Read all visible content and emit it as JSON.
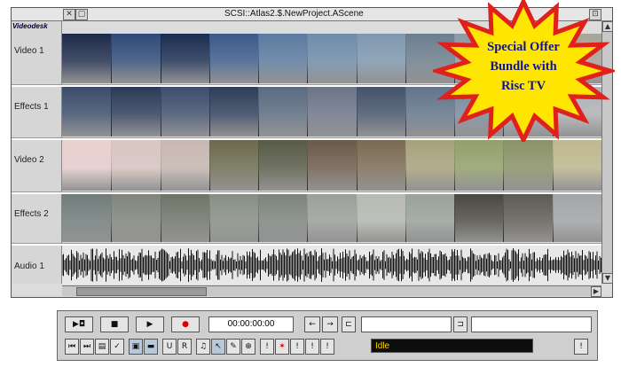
{
  "window": {
    "title": "SCSI::Atlas2.$.NewProject.AScene",
    "app_badge": "Videodesk",
    "close_glyph": "✕",
    "iconize_glyph": "▢",
    "toggle_glyph": "⊡"
  },
  "tracks": [
    {
      "label": "Video 1",
      "colors": [
        "#1d2a4a",
        "#2e4a78",
        "#1a2c50",
        "#3b5a8a",
        "#5a7aa0",
        "#6e8caa",
        "#7f98b0",
        "#6c7e8e",
        "#8a9aa6",
        "#b9c0c4",
        "#a8a49a"
      ]
    },
    {
      "label": "Effects 1",
      "colors": [
        "#3a4c6a",
        "#2c3a58",
        "#3d4d6c",
        "#2f3d5a",
        "#5a6a80",
        "#6c7488",
        "#44526a",
        "#62748a",
        "#7a8a9c",
        "#9aa6b2",
        "#b0b4b6"
      ]
    },
    {
      "label": "Video 2",
      "colors": [
        "#e9d0cf",
        "#d9c6c2",
        "#c8b8b2",
        "#6b6a4e",
        "#565a46",
        "#6a5a4a",
        "#7a6a52",
        "#a8a27a",
        "#93a06a",
        "#8a9266",
        "#bfb88e"
      ]
    },
    {
      "label": "Effects 2",
      "colors": [
        "#6f7c7a",
        "#80847a",
        "#6e7468",
        "#878f84",
        "#7c847c",
        "#9ca09a",
        "#b6bab2",
        "#9aa29c",
        "#4a4842",
        "#5c5a52",
        "#a2a6a8"
      ]
    },
    {
      "label": "Audio 1",
      "colors": []
    }
  ],
  "transport": {
    "rewind": "▶◘",
    "stop": "■",
    "play": "▶",
    "record": "●",
    "timecode": "00:00:00:00",
    "step_back": "←",
    "step_fwd": "→",
    "mark_in": "⊏",
    "mark_out": "⊐"
  },
  "tools": {
    "prev": "⏮",
    "next": "⏭",
    "bin": "▤",
    "check": "✓",
    "save": "▣",
    "folder": "▬",
    "u": "U",
    "r": "R",
    "note": "♫",
    "pointer": "↖",
    "razor": "✎",
    "zoom": "⊕",
    "mark1": "!",
    "cut": "✶",
    "mark2": "!",
    "mark3": "!",
    "mark4": "!",
    "mark5": "!"
  },
  "status": "Idle",
  "promo": {
    "line1": "Special Offer",
    "line2": "Bundle with",
    "line3": "Risc TV"
  },
  "colors": {
    "burst_fill": "#ffe600",
    "burst_stroke": "#e0201a",
    "promo_text": "#14148a",
    "status_text": "#ffd200"
  }
}
